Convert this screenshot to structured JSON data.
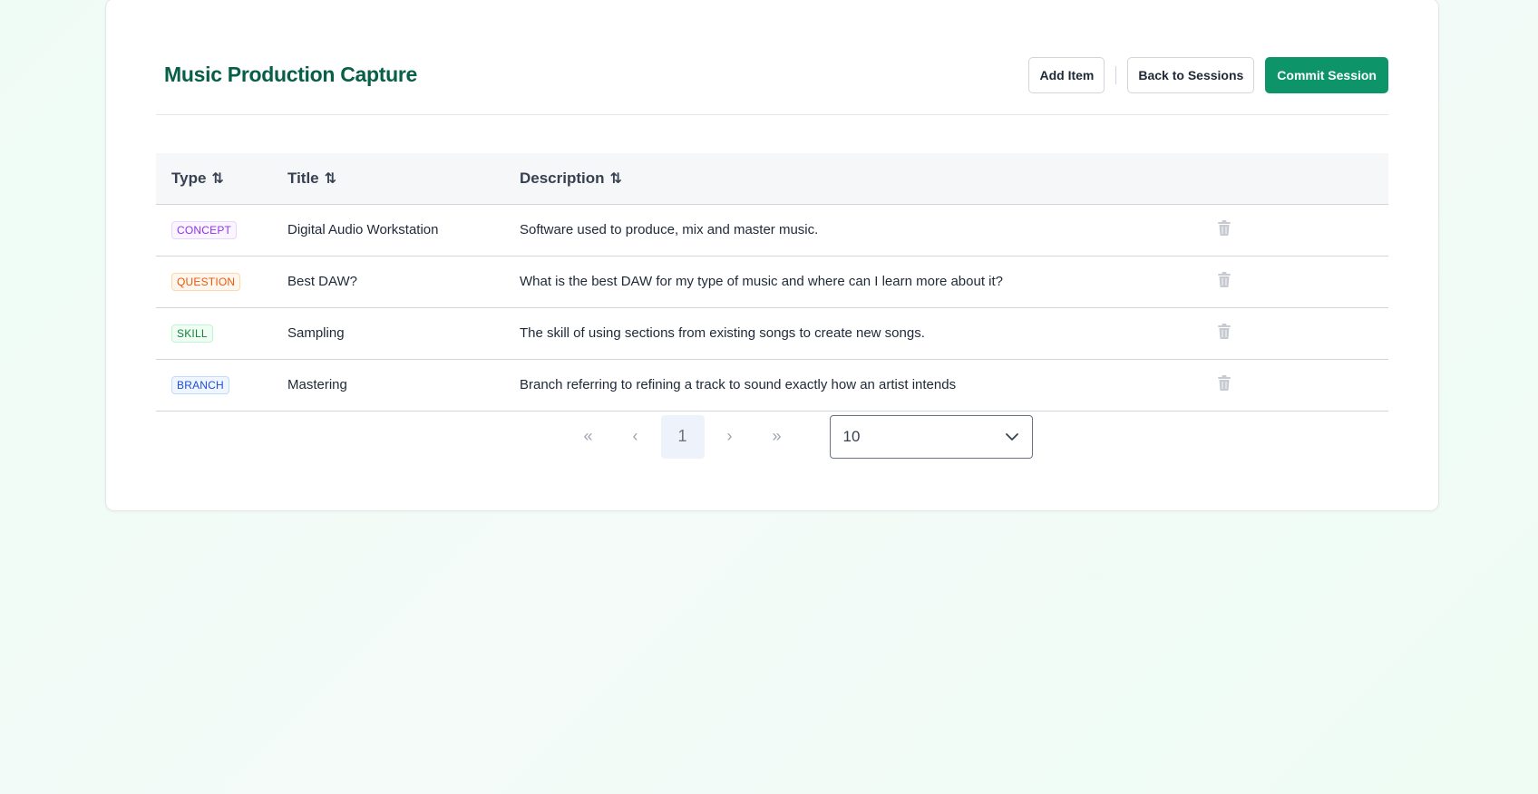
{
  "page": {
    "title": "Music Production Capture"
  },
  "actions": {
    "add_item": "Add Item",
    "back_to_sessions": "Back to Sessions",
    "commit_session": "Commit Session"
  },
  "table": {
    "columns": [
      "Type",
      "Title",
      "Description"
    ],
    "rows": [
      {
        "type": "CONCEPT",
        "type_color": "#9333ea",
        "type_bg": "#faf5ff",
        "type_border": "#e9d5ff",
        "title": "Digital Audio Workstation",
        "description": "Software used to produce, mix and master music."
      },
      {
        "type": "QUESTION",
        "type_color": "#ea580c",
        "type_bg": "#fff7ed",
        "type_border": "#fed7aa",
        "title": "Best DAW?",
        "description": "What is the best DAW for my type of music and where can I learn more about it?"
      },
      {
        "type": "SKILL",
        "type_color": "#15803d",
        "type_bg": "#f0fdf4",
        "type_border": "#bbf7d0",
        "title": "Sampling",
        "description": "The skill of using sections from existing songs to create new songs."
      },
      {
        "type": "BRANCH",
        "type_color": "#1d4ed8",
        "type_bg": "#eff6ff",
        "type_border": "#bfdbfe",
        "title": "Mastering",
        "description": "Branch referring to refining a track to sound exactly how an artist intends"
      }
    ]
  },
  "pagination": {
    "first": "«",
    "prev": "‹",
    "current_page": "1",
    "next": "›",
    "last": "»",
    "page_size": "10"
  },
  "colors": {
    "accent": "#0d9468",
    "title": "#065f46"
  }
}
